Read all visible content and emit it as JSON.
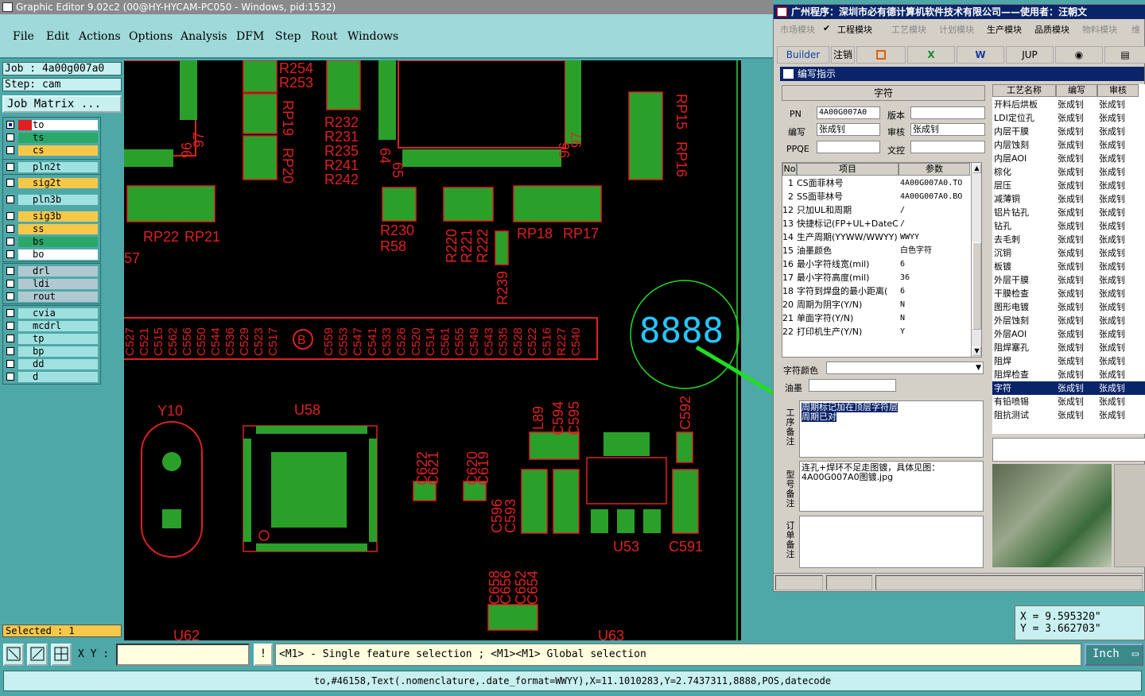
{
  "window": {
    "title": "Graphic Editor 9.02c2 (00@HY-HYCAM-PC050 - Windows, pid:1532)"
  },
  "menu": [
    "File",
    "Edit",
    "Actions",
    "Options",
    "Analysis",
    "DFM",
    "Step",
    "Rout",
    "Windows"
  ],
  "job": {
    "job_label": "Job : 4a00g007a0",
    "step_label": "Step: cam",
    "matrix_button": "Job Matrix ..."
  },
  "layers": [
    {
      "name": "to",
      "color": "#ffffff",
      "swatch": "#e02020",
      "checked": true
    },
    {
      "name": "ts",
      "color": "#2aa86a",
      "swatch": "#2aa86a",
      "checked": false
    },
    {
      "name": "cs",
      "color": "#f5c84a",
      "swatch": "#f5c84a",
      "checked": false
    },
    {
      "name": "pln2t",
      "color": "#9fe0e0",
      "swatch": "#9fe0e0",
      "checked": false
    },
    {
      "name": "sig2t",
      "color": "#f5c84a",
      "swatch": "#f5c84a",
      "checked": false
    },
    {
      "name": "pln3b",
      "color": "#9fe0e0",
      "swatch": "#9fe0e0",
      "checked": false
    },
    {
      "name": "sig3b",
      "color": "#f5c84a",
      "swatch": "#f5c84a",
      "checked": false
    },
    {
      "name": "ss",
      "color": "#f5c84a",
      "swatch": "#f5c84a",
      "checked": false
    },
    {
      "name": "bs",
      "color": "#2aa86a",
      "swatch": "#2aa86a",
      "checked": false
    },
    {
      "name": "bo",
      "color": "#ffffff",
      "swatch": "#ffffff",
      "checked": false
    },
    {
      "name": "drl",
      "color": "#b0c8d0",
      "swatch": "#b0c8d0",
      "checked": false
    },
    {
      "name": "ldi",
      "color": "#b0c8d0",
      "swatch": "#b0c8d0",
      "checked": false
    },
    {
      "name": "rout",
      "color": "#b0c8d0",
      "swatch": "#b0c8d0",
      "checked": false
    },
    {
      "name": "cvia",
      "color": "#9fe0e0",
      "swatch": "#9fe0e0",
      "checked": false
    },
    {
      "name": "mcdrl",
      "color": "#9fe0e0",
      "swatch": "#9fe0e0",
      "checked": false
    },
    {
      "name": "tp",
      "color": "#9fe0e0",
      "swatch": "#9fe0e0",
      "checked": false
    },
    {
      "name": "bp",
      "color": "#9fe0e0",
      "swatch": "#9fe0e0",
      "checked": false
    },
    {
      "name": "dd",
      "color": "#9fe0e0",
      "swatch": "#9fe0e0",
      "checked": false
    },
    {
      "name": "d",
      "color": "#9fe0e0",
      "swatch": "#9fe0e0",
      "checked": false
    }
  ],
  "selected": "Selected : 1",
  "canvas": {
    "labels": [
      "R254",
      "R253",
      "RP19",
      "RP20",
      "R232",
      "R231",
      "R235",
      "R241",
      "R242",
      "64",
      "65",
      "96",
      "97",
      "96",
      "97",
      "RP15",
      "RP16",
      "RP22",
      "RP21",
      "R230",
      "R58",
      "R220",
      "R221",
      "R222",
      "R239",
      "RP18",
      "RP17",
      "57",
      "Y10",
      "U58",
      "L89",
      "C594",
      "C595",
      "C592",
      "C622",
      "C621",
      "C620",
      "C619",
      "C596",
      "C593",
      "U53",
      "C591",
      "C658",
      "C656",
      "C652",
      "C654",
      "U62",
      "U63"
    ],
    "bus_labels": [
      "C527",
      "C521",
      "C515",
      "C562",
      "C556",
      "C550",
      "C544",
      "C536",
      "C529",
      "C523",
      "C517",
      "C559",
      "C553",
      "C547",
      "C541",
      "C533",
      "C526",
      "C520",
      "C514",
      "C561",
      "C555",
      "C549",
      "C543",
      "C535",
      "C528",
      "C522",
      "C516",
      "R227",
      "C540"
    ],
    "bus_marker": "B",
    "datecode": "8888"
  },
  "toolbar": {
    "xy_label": "X Y :",
    "xy_value": "",
    "info_button": "!",
    "message": "<M1> - Single feature selection ; <M1><M1> Global selection",
    "unit": "Inch"
  },
  "status": "to,#46158,Text(.nomenclature,.date_format=WWYY),X=11.1010283,Y=2.7437311,8888,POS,datecode",
  "coords": {
    "x": "X  =  9.595320\"",
    "y": "Y  =  3.662703\""
  },
  "erp": {
    "title": "广州程序：深圳市必有德计算机软件技术有限公司——使用者：汪朝文",
    "menu": [
      "市场模块",
      "工程模块",
      "工艺模块",
      "计划模块",
      "生产模块",
      "品质模块",
      "物料模块",
      "维"
    ],
    "toolbar": [
      "Builder",
      "注销",
      "JUP"
    ],
    "subtitle": "编写指示",
    "section": "字符",
    "form": {
      "pn_label": "PN",
      "pn": "4A00G007A0",
      "version_label": "版本",
      "version": "",
      "writer_label": "编写",
      "writer": "张成钊",
      "reviewer_label": "审核",
      "reviewer": "张成钊",
      "ppqe_label": "PPQE",
      "ppqe": "",
      "control_label": "文控",
      "control": ""
    },
    "item_headers": [
      "No",
      "项目",
      "参数"
    ],
    "items": [
      [
        "1",
        "CS面菲林号",
        "4A00G007A0.TO"
      ],
      [
        "2",
        "SS面菲林号",
        "4A00G007A0.BO"
      ],
      [
        "12",
        "只加UL和周期",
        "/"
      ],
      [
        "13",
        "快捷标记(FP+UL+DateCo",
        "/"
      ],
      [
        "14",
        "生产周期(YYWW/WWYY)",
        "WWYY"
      ],
      [
        "15",
        "油墨颜色",
        "白色字符"
      ],
      [
        "16",
        "最小字符线宽(mil)",
        "6"
      ],
      [
        "17",
        "最小字符高度(mil)",
        "36"
      ],
      [
        "18",
        "字符到焊盘的最小距离(",
        "6"
      ],
      [
        "20",
        "周期为阴字(Y/N)",
        "N"
      ],
      [
        "21",
        "单面字符(Y/N)",
        "N"
      ],
      [
        "22",
        "打印机生产(Y/N)",
        "Y"
      ]
    ],
    "char_color_label": "字符颜色",
    "ink_label": "油墨",
    "remark_label": "工序备注",
    "remark_text": "周期标记加在顶层字符层\n周期已对",
    "model_remark_label": "型号备注",
    "model_remark_text": "连孔+焊环不足走图镀，具体见图：\n4A00G007A0图镀.jpg",
    "order_remark_label": "订单备注",
    "proc_headers": [
      "工艺名称",
      "编写",
      "审核"
    ],
    "procs": [
      [
        "开料后烘板",
        "张成钊",
        "张成钊"
      ],
      [
        "LDI定位孔",
        "张成钊",
        "张成钊"
      ],
      [
        "内层干膜",
        "张成钊",
        "张成钊"
      ],
      [
        "内层蚀刻",
        "张成钊",
        "张成钊"
      ],
      [
        "内层AOI",
        "张成钊",
        "张成钊"
      ],
      [
        "棕化",
        "张成钊",
        "张成钊"
      ],
      [
        "层压",
        "张成钊",
        "张成钊"
      ],
      [
        "减薄铜",
        "张成钊",
        "张成钊"
      ],
      [
        "铝片钻孔",
        "张成钊",
        "张成钊"
      ],
      [
        "钻孔",
        "张成钊",
        "张成钊"
      ],
      [
        "去毛刺",
        "张成钊",
        "张成钊"
      ],
      [
        "沉铜",
        "张成钊",
        "张成钊"
      ],
      [
        "板镀",
        "张成钊",
        "张成钊"
      ],
      [
        "外层干膜",
        "张成钊",
        "张成钊"
      ],
      [
        "干膜检查",
        "张成钊",
        "张成钊"
      ],
      [
        "图形电镀",
        "张成钊",
        "张成钊"
      ],
      [
        "外层蚀刻",
        "张成钊",
        "张成钊"
      ],
      [
        "外层AOI",
        "张成钊",
        "张成钊"
      ],
      [
        "阻焊塞孔",
        "张成钊",
        "张成钊"
      ],
      [
        "阻焊",
        "张成钊",
        "张成钊"
      ],
      [
        "阻焊检查",
        "张成钊",
        "张成钊"
      ],
      [
        "字符",
        "张成钊",
        "张成钊"
      ],
      [
        "有铅喷锡",
        "张成钊",
        "张成钊"
      ],
      [
        "阻抗测试",
        "张成钊",
        "张成钊"
      ]
    ],
    "selected_proc": "字符"
  }
}
